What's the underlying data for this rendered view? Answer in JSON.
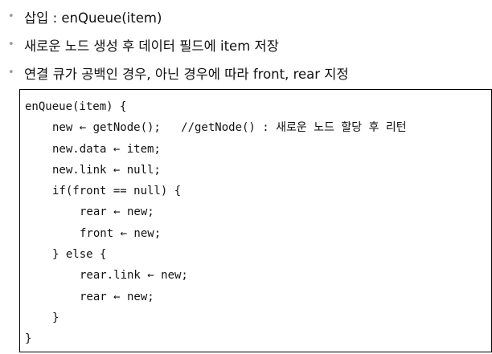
{
  "bullets": [
    "삽입 : enQueue(item)",
    "새로운 노드 생성 후 데이터 필드에 item 저장",
    "연결 큐가 공백인 경우, 아닌 경우에 따라 front, rear 지정"
  ],
  "bullet_symbol": "•",
  "code": [
    "enQueue(item) {",
    "new ← getNode();   //getNode() : 새로운 노드 할당 후 리턴",
    "new.data ← item;",
    "new.link ← null;",
    "if(front == null) {",
    "rear ← new;",
    "front ← new;",
    "} else {",
    "rear.link ← new;",
    "rear ← new;",
    "}",
    "}"
  ]
}
